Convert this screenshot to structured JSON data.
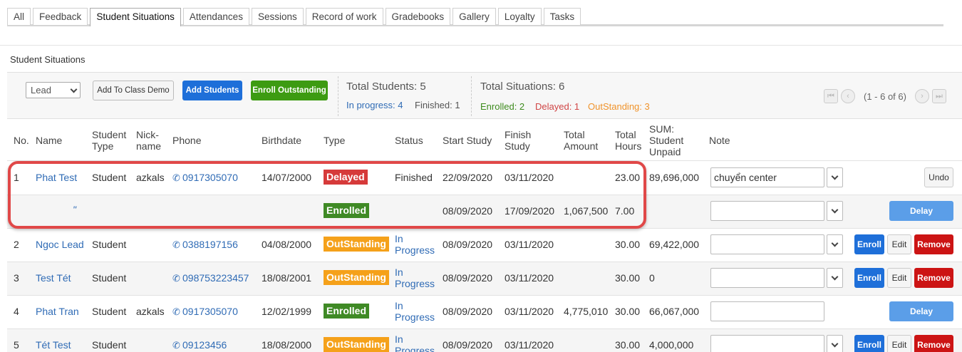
{
  "tabs": [
    "All",
    "Feedback",
    "Student Situations",
    "Attendances",
    "Sessions",
    "Record of work",
    "Gradebooks",
    "Gallery",
    "Loyalty",
    "Tasks"
  ],
  "section_title": "Student Situations",
  "toolbar": {
    "select_value": "Lead",
    "add_class_demo": "Add To Class Demo",
    "add_students": "Add Students",
    "enroll_outstanding": "Enroll Outstanding",
    "total_students": "Total Students: 5",
    "in_progress": "In progress: 4",
    "finished": "Finished: 1",
    "total_situations": "Total Situations: 6",
    "enrolled": "Enrolled: 2",
    "delayed": "Delayed: 1",
    "outstanding": "OutStanding: 3",
    "pager_text": "(1 - 6 of 6)"
  },
  "columns": {
    "no": "No.",
    "name": "Name",
    "student_type": [
      "Student",
      "Type"
    ],
    "nickname": [
      "Nick-",
      "name"
    ],
    "phone": "Phone",
    "birthdate": "Birthdate",
    "type": "Type",
    "status": "Status",
    "start_study": "Start Study",
    "finish_study": [
      "Finish",
      "Study"
    ],
    "total_amount": [
      "Total",
      "Amount"
    ],
    "total_hours": [
      "Total",
      "Hours"
    ],
    "sum_unpaid": [
      "SUM:",
      "Student",
      "Unpaid"
    ],
    "note": "Note"
  },
  "rows": [
    {
      "no": "1",
      "name": "Phat Test",
      "stype": "Student",
      "nick": "azkals",
      "phone": "0917305070",
      "birth": "14/07/2000",
      "type": "Delayed",
      "status": "Finished",
      "start": "22/09/2020",
      "finish": "03/11/2020",
      "amount": "",
      "hours": "23.00",
      "unpaid": "89,696,000",
      "note": "chuyển center",
      "action": "Undo"
    },
    {
      "no": "",
      "name": "\"",
      "stype": "",
      "nick": "",
      "phone": "",
      "birth": "",
      "type": "Enrolled",
      "status": "",
      "start": "08/09/2020",
      "finish": "17/09/2020",
      "amount": "1,067,500",
      "hours": "7.00",
      "unpaid": "",
      "note": "",
      "action": "Delay"
    },
    {
      "no": "2",
      "name": "Ngoc Lead",
      "stype": "Student",
      "nick": "",
      "phone": "0388197156",
      "birth": "04/08/2000",
      "type": "OutStanding",
      "status": [
        "In",
        "Progress"
      ],
      "start": "08/09/2020",
      "finish": "03/11/2020",
      "amount": "",
      "hours": "30.00",
      "unpaid": "69,422,000",
      "note": "",
      "actions": [
        "Enroll",
        "Edit",
        "Remove"
      ]
    },
    {
      "no": "3",
      "name": "Test Tét",
      "stype": "Student",
      "nick": "",
      "phone": "098753223457",
      "birth": "18/08/2001",
      "type": "OutStanding",
      "status": [
        "In",
        "Progress"
      ],
      "start": "08/09/2020",
      "finish": "03/11/2020",
      "amount": "",
      "hours": "30.00",
      "unpaid": "0",
      "note": "",
      "actions": [
        "Enroll",
        "Edit",
        "Remove"
      ]
    },
    {
      "no": "4",
      "name": "Phat Tran",
      "stype": "Student",
      "nick": "azkals",
      "phone": "0917305070",
      "birth": "12/02/1999",
      "type": "Enrolled",
      "status": [
        "In",
        "Progress"
      ],
      "start": "08/09/2020",
      "finish": "03/11/2020",
      "amount": "4,775,010",
      "hours": "30.00",
      "unpaid": "66,067,000",
      "note": "",
      "action": "Delay"
    },
    {
      "no": "5",
      "name": "Tét Test",
      "stype": "Student",
      "nick": "",
      "phone": "09123456",
      "birth": "18/08/2000",
      "type": "OutStanding",
      "status": [
        "In",
        "Progress"
      ],
      "start": "08/09/2020",
      "finish": "03/11/2020",
      "amount": "",
      "hours": "30.00",
      "unpaid": "4,000,000",
      "note": "",
      "actions": [
        "Enroll",
        "Edit",
        "Remove"
      ]
    }
  ]
}
